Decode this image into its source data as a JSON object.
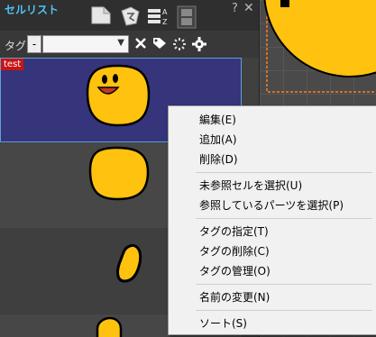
{
  "panel": {
    "title": "セルリスト",
    "help": "?",
    "close": "✕"
  },
  "toolbar": {
    "tag_label": "タグ",
    "tag_prefix": "-",
    "tag_value": ""
  },
  "list": {
    "first_badge": "test"
  },
  "context_menu": {
    "edit": "編集(E)",
    "add": "追加(A)",
    "delete": "削除(D)",
    "select_unreferenced": "未参照セルを選択(U)",
    "select_referencing_parts": "参照しているパーツを選択(P)",
    "tag_assign": "タグの指定(T)",
    "tag_remove": "タグの削除(C)",
    "tag_manage": "タグの管理(O)",
    "rename": "名前の変更(N)",
    "sort": "ソート(S)"
  },
  "colors": {
    "accent": "#4fc3f7",
    "selected_row": "#36347a",
    "badge": "#c81414",
    "sprite_yellow": "#ffc20e"
  }
}
